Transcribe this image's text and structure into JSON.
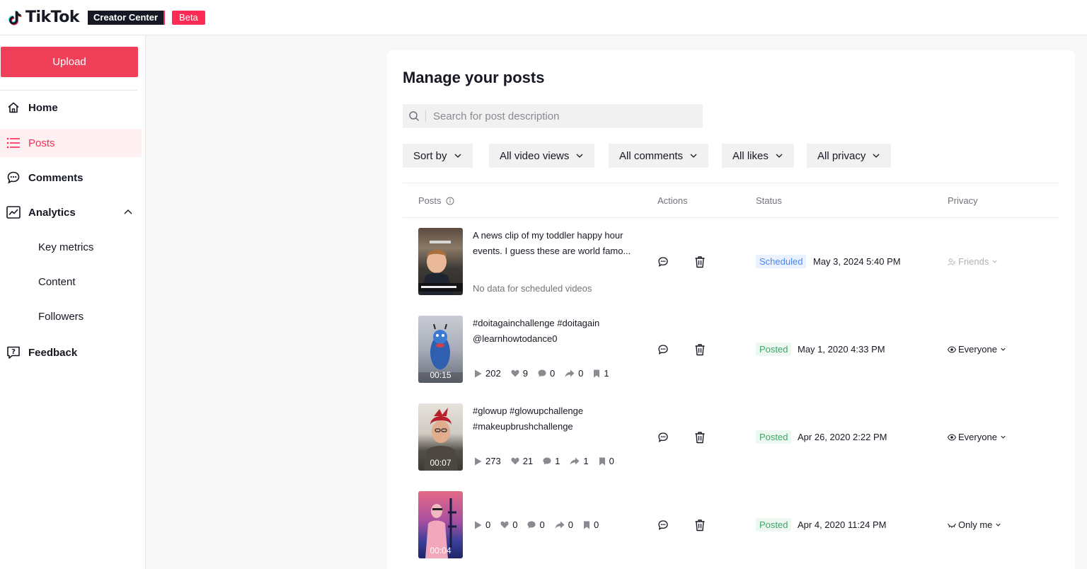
{
  "header": {
    "brand": "TikTok",
    "creator_center": "Creator Center",
    "beta": "Beta"
  },
  "sidebar": {
    "upload_label": "Upload",
    "items": [
      {
        "label": "Home",
        "icon": "home-icon"
      },
      {
        "label": "Posts",
        "icon": "list-icon",
        "active": true
      },
      {
        "label": "Comments",
        "icon": "comment-icon"
      },
      {
        "label": "Analytics",
        "icon": "analytics-icon",
        "expanded": true
      },
      {
        "label": "Feedback",
        "icon": "feedback-icon"
      }
    ],
    "sub_items": [
      "Key metrics",
      "Content",
      "Followers"
    ]
  },
  "main": {
    "title": "Manage your posts",
    "search_placeholder": "Search for post description",
    "filters": [
      "Sort by",
      "All video views",
      "All comments",
      "All likes",
      "All privacy"
    ],
    "columns": {
      "posts": "Posts",
      "actions": "Actions",
      "status": "Status",
      "privacy": "Privacy"
    },
    "posts": [
      {
        "desc_line1": "A news clip of my toddler happy hour",
        "desc_line2": "events. I guess these are world famo...",
        "no_data": "No data for scheduled videos",
        "duration": "",
        "status": "Scheduled",
        "date": "May 3, 2024 5:40 PM",
        "privacy": "Friends"
      },
      {
        "desc_line1": "#doitagainchallenge #doitagain",
        "desc_line2": "@learnhowtodance0",
        "duration": "00:15",
        "views": "202",
        "likes": "9",
        "comments": "0",
        "shares": "0",
        "saves": "1",
        "status": "Posted",
        "date": "May 1, 2020 4:33 PM",
        "privacy": "Everyone"
      },
      {
        "desc_line1": "#glowup #glowupchallenge",
        "desc_line2": "#makeupbrushchallenge",
        "duration": "00:07",
        "views": "273",
        "likes": "21",
        "comments": "1",
        "shares": "1",
        "saves": "0",
        "status": "Posted",
        "date": "Apr 26, 2020 2:22 PM",
        "privacy": "Everyone"
      },
      {
        "desc_line1": "",
        "desc_line2": "",
        "duration": "00:04",
        "views": "0",
        "likes": "0",
        "comments": "0",
        "shares": "0",
        "saves": "0",
        "status": "Posted",
        "date": "Apr 4, 2020 11:24 PM",
        "privacy": "Only me"
      }
    ]
  },
  "colors": {
    "accent": "#fe2c55",
    "scheduled": "#4d86f0",
    "posted": "#3fa66a"
  }
}
